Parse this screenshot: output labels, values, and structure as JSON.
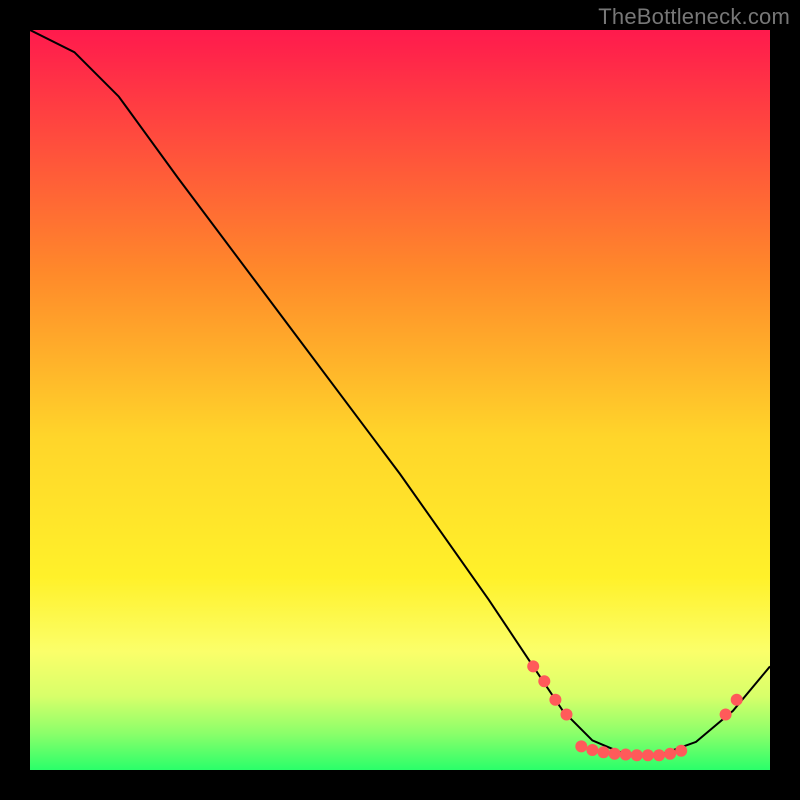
{
  "watermark": {
    "text": "TheBottleneck.com"
  },
  "chart_data": {
    "type": "line",
    "title": "",
    "xlabel": "",
    "ylabel": "",
    "xlim": [
      0,
      100
    ],
    "ylim": [
      0,
      100
    ],
    "grid": false,
    "background_gradient": {
      "stops": [
        {
          "offset": 0,
          "color": "#ff1a4d"
        },
        {
          "offset": 33,
          "color": "#ff8a2a"
        },
        {
          "offset": 55,
          "color": "#ffd52a"
        },
        {
          "offset": 74,
          "color": "#fff12a"
        },
        {
          "offset": 84,
          "color": "#fbff6a"
        },
        {
          "offset": 90,
          "color": "#d8ff6a"
        },
        {
          "offset": 95,
          "color": "#8cff6a"
        },
        {
          "offset": 100,
          "color": "#2aff6a"
        }
      ]
    },
    "curve": {
      "color": "#000000",
      "width": 2,
      "points": [
        {
          "x": 0,
          "y": 100
        },
        {
          "x": 6,
          "y": 97
        },
        {
          "x": 12,
          "y": 91
        },
        {
          "x": 20,
          "y": 80
        },
        {
          "x": 35,
          "y": 60
        },
        {
          "x": 50,
          "y": 40
        },
        {
          "x": 62,
          "y": 23
        },
        {
          "x": 68,
          "y": 14
        },
        {
          "x": 72,
          "y": 8
        },
        {
          "x": 76,
          "y": 4
        },
        {
          "x": 80,
          "y": 2.3
        },
        {
          "x": 85,
          "y": 2.0
        },
        {
          "x": 90,
          "y": 3.8
        },
        {
          "x": 95,
          "y": 8
        },
        {
          "x": 100,
          "y": 14
        }
      ]
    },
    "markers": {
      "color": "#ff5a5a",
      "radius": 6,
      "points": [
        {
          "x": 68,
          "y": 14
        },
        {
          "x": 69.5,
          "y": 12
        },
        {
          "x": 71,
          "y": 9.5
        },
        {
          "x": 72.5,
          "y": 7.5
        },
        {
          "x": 74.5,
          "y": 3.2
        },
        {
          "x": 76,
          "y": 2.7
        },
        {
          "x": 77.5,
          "y": 2.4
        },
        {
          "x": 79,
          "y": 2.2
        },
        {
          "x": 80.5,
          "y": 2.1
        },
        {
          "x": 82,
          "y": 2.0
        },
        {
          "x": 83.5,
          "y": 2.0
        },
        {
          "x": 85,
          "y": 2.0
        },
        {
          "x": 86.5,
          "y": 2.2
        },
        {
          "x": 88,
          "y": 2.6
        },
        {
          "x": 94,
          "y": 7.5
        },
        {
          "x": 95.5,
          "y": 9.5
        }
      ]
    }
  }
}
